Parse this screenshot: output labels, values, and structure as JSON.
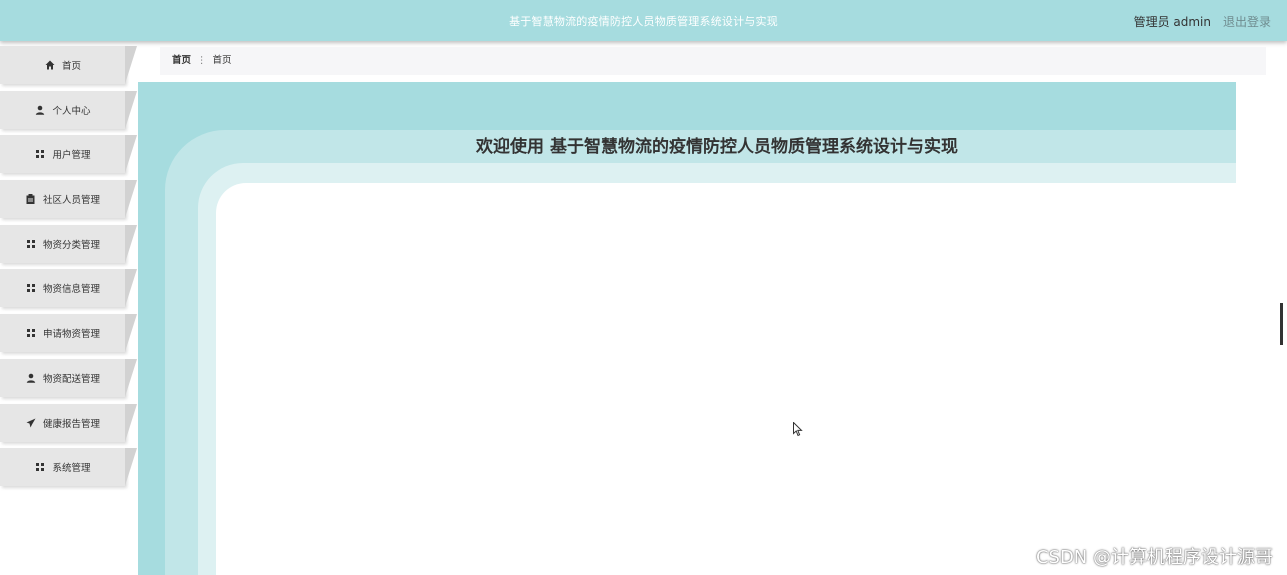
{
  "header": {
    "title": "基于智慧物流的疫情防控人员物质管理系统设计与实现",
    "user": "管理员 admin",
    "logout": "退出登录"
  },
  "sidebar": {
    "items": [
      {
        "label": "首页",
        "icon": "home-icon"
      },
      {
        "label": "个人中心",
        "icon": "user-icon"
      },
      {
        "label": "用户管理",
        "icon": "grid-icon"
      },
      {
        "label": "社区人员管理",
        "icon": "clipboard-icon"
      },
      {
        "label": "物资分类管理",
        "icon": "grid-icon"
      },
      {
        "label": "物资信息管理",
        "icon": "grid-icon"
      },
      {
        "label": "申请物资管理",
        "icon": "grid-icon"
      },
      {
        "label": "物资配送管理",
        "icon": "user-icon"
      },
      {
        "label": "健康报告管理",
        "icon": "send-icon"
      },
      {
        "label": "系统管理",
        "icon": "grid-icon"
      }
    ]
  },
  "breadcrumb": {
    "home": "首页",
    "current": "首页"
  },
  "main": {
    "welcome": "欢迎使用 基于智慧物流的疫情防控人员物质管理系统设计与实现"
  },
  "watermark": "CSDN @计算机程序设计源哥",
  "colors": {
    "accent": "#a6dcdf",
    "accent_light": "#c1e6e8",
    "accent_lighter": "#ddf1f2",
    "sidebar_item": "#e6e6e6"
  }
}
